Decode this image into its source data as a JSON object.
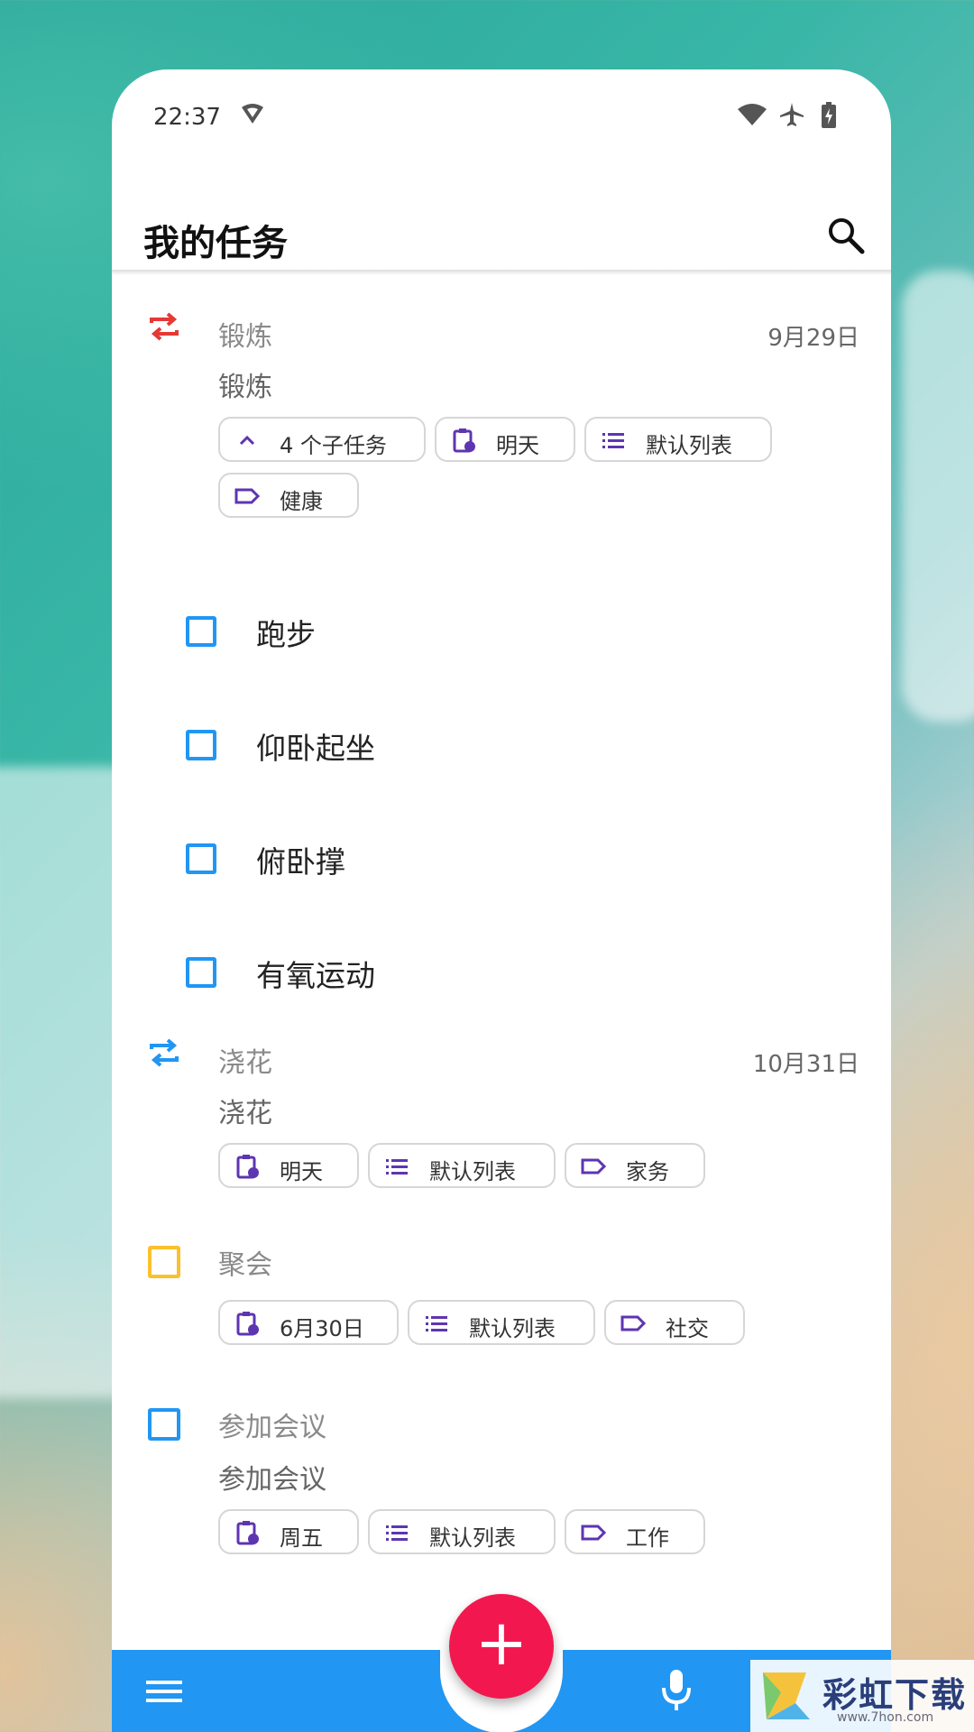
{
  "status_bar": {
    "time": "22:37"
  },
  "app_bar": {
    "title": "我的任务"
  },
  "tasks": [
    {
      "title": "锻炼",
      "description": "锻炼",
      "date": "9月29日",
      "chips": [
        "4 个子任务",
        "明天",
        "默认列表",
        "健康"
      ],
      "subtasks": [
        "跑步",
        "仰卧起坐",
        "俯卧撑",
        "有氧运动"
      ]
    },
    {
      "title": "浇花",
      "description": "浇花",
      "date": "10月31日",
      "chips": [
        "明天",
        "默认列表",
        "家务"
      ]
    },
    {
      "title": "聚会",
      "chips": [
        "6月30日",
        "默认列表",
        "社交"
      ]
    },
    {
      "title": "参加会议",
      "description": "参加会议",
      "chips": [
        "周五",
        "默认列表",
        "工作"
      ]
    }
  ],
  "fab": {
    "label": "+"
  },
  "watermark": {
    "text": "彩虹下载",
    "url": "www.7hon.com"
  },
  "colors": {
    "accent": "#2196f3",
    "fab": "#f2184f",
    "repeat_red": "#e53935",
    "priority_yellow": "#fbc02d",
    "chip_icon": "#5e35b1"
  }
}
